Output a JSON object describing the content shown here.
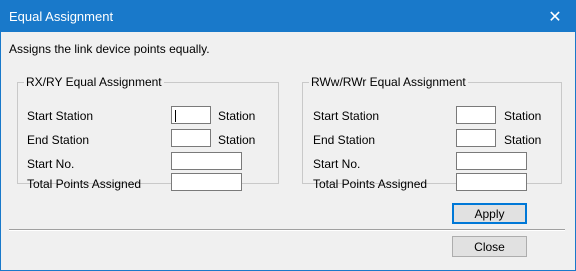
{
  "window": {
    "title": "Equal Assignment",
    "close_icon": "close-icon"
  },
  "description": "Assigns the link device points equally.",
  "groups": [
    {
      "legend": "RX/RY Equal Assignment",
      "start_station_label": "Start Station",
      "end_station_label": "End Station",
      "station_unit": "Station",
      "start_no_label": "Start No.",
      "total_points_label": "Total Points Assigned",
      "start_station_value": "",
      "end_station_value": "",
      "start_no_value": "",
      "total_points_value": ""
    },
    {
      "legend": "RWw/RWr Equal Assignment",
      "start_station_label": "Start Station",
      "end_station_label": "End Station",
      "station_unit": "Station",
      "start_no_label": "Start No.",
      "total_points_label": "Total Points Assigned",
      "start_station_value": "",
      "end_station_value": "",
      "start_no_value": "",
      "total_points_value": ""
    }
  ],
  "buttons": {
    "apply": "Apply",
    "close": "Close"
  },
  "colors": {
    "titlebar": "#1979ca",
    "dialog_bg": "#f0f0f0",
    "button_bg": "#e1e1e1",
    "default_button_border": "#0078d7"
  }
}
